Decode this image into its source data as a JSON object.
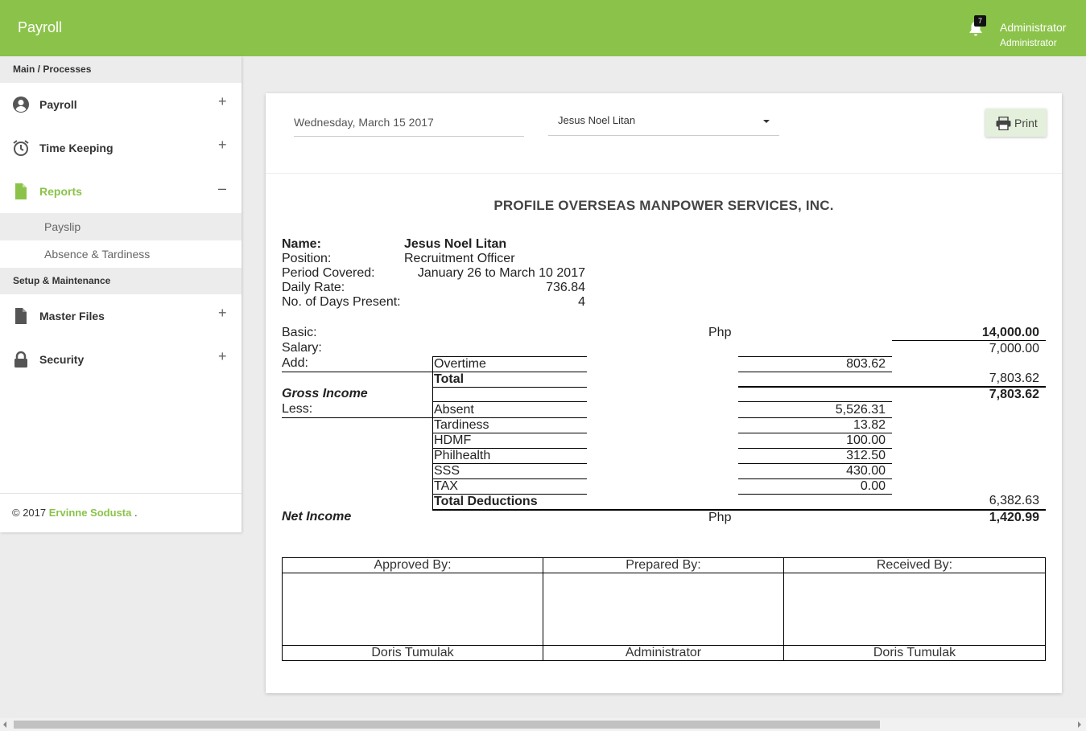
{
  "app": {
    "brand": "Payroll",
    "notification_count": "7",
    "user_name": "Administrator",
    "user_role": "Administrator",
    "accent_color": "#8bc34a"
  },
  "sidebar": {
    "section_main": "Main / Processes",
    "items": [
      {
        "label": "Payroll",
        "icon": "user-circle-icon",
        "toggle": "+"
      },
      {
        "label": "Time Keeping",
        "icon": "alarm-clock-icon",
        "toggle": "+"
      },
      {
        "label": "Reports",
        "icon": "file-icon",
        "toggle": "–"
      }
    ],
    "subitems": [
      "Payslip",
      "Absence & Tardiness"
    ],
    "section_setup": "Setup & Maintenance",
    "setup_items": [
      {
        "label": "Master Files",
        "icon": "file-icon",
        "toggle": "+"
      },
      {
        "label": "Security",
        "icon": "lock-icon",
        "toggle": "+"
      }
    ],
    "footer_prefix": "© 2017",
    "footer_link": "Ervinne Sodusta",
    "footer_suffix": "."
  },
  "toolbar": {
    "date": "Wednesday, March 15 2017",
    "employee": "Jesus Noel Litan",
    "print_label": "Print"
  },
  "payslip": {
    "company": "PROFILE OVERSEAS MANPOWER SERVICES, INC.",
    "labels": {
      "name": "Name:",
      "position": "Position:",
      "period": "Period Covered:",
      "daily_rate": "Daily Rate:",
      "days_present": "No. of Days Present:"
    },
    "values": {
      "name": "Jesus Noel Litan",
      "position": "Recruitment Officer",
      "period": "January 26 to March 10 2017",
      "daily_rate": "736.84",
      "days_present": "4"
    },
    "basic_label": "Basic:",
    "currency": "Php",
    "basic": "14,000.00",
    "salary_label": "Salary:",
    "salary": "7,000.00",
    "add_label": "Add:",
    "overtime_label": "Overtime",
    "overtime": "803.62",
    "total_label": "Total",
    "total": "7,803.62",
    "gross_label": "Gross Income",
    "gross": "7,803.62",
    "less_label": "Less:",
    "deductions": [
      {
        "label": "Absent",
        "value": "5,526.31"
      },
      {
        "label": "Tardiness",
        "value": "13.82"
      },
      {
        "label": "HDMF",
        "value": "100.00"
      },
      {
        "label": "Philhealth",
        "value": "312.50"
      },
      {
        "label": "SSS",
        "value": "430.00"
      },
      {
        "label": "TAX",
        "value": "0.00"
      }
    ],
    "total_deductions_label": "Total Deductions",
    "total_deductions": "6,382.63",
    "net_label": "Net Income",
    "net": "1,420.99"
  },
  "signatures": {
    "approved_label": "Approved By:",
    "prepared_label": "Prepared By:",
    "received_label": "Received By:",
    "approved_name": "Doris Tumulak",
    "prepared_name": "Administrator",
    "received_name": "Doris Tumulak"
  }
}
